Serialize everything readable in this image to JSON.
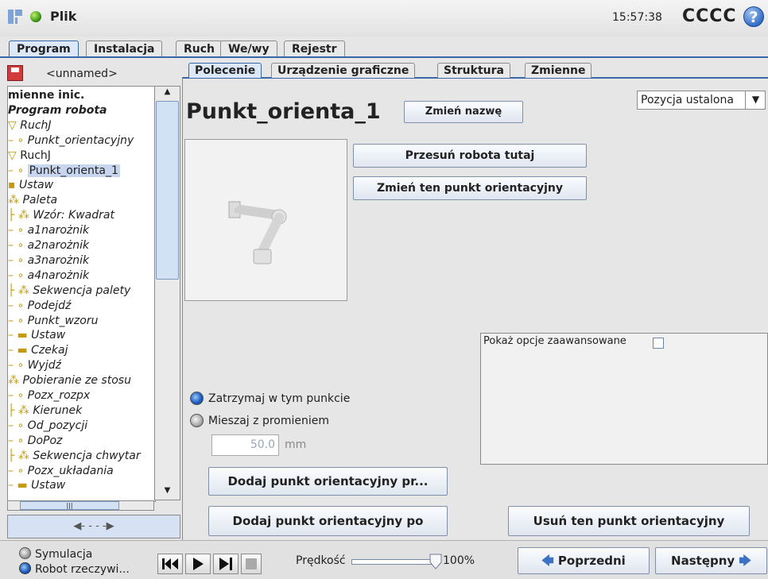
{
  "header": {
    "app_title": "Plik",
    "clock": "15:57:38",
    "robot_name": "CCCC",
    "help": "?"
  },
  "main_tabs": [
    "Program",
    "Instalacja",
    "Ruch",
    "We/wy",
    "Rejestr"
  ],
  "left": {
    "file_name": "<unnamed>",
    "tree": [
      {
        "label": "mienne inic.",
        "style": "bold",
        "prefix": ""
      },
      {
        "label": "Program robota",
        "style": "bold-italic",
        "prefix": ""
      },
      {
        "label": "RuchJ",
        "style": "italic",
        "prefix": "▽ "
      },
      {
        "label": "Punkt_orientacyjny",
        "style": "italic",
        "prefix": "– ∘ "
      },
      {
        "label": "RuchJ",
        "style": "normal",
        "prefix": "▽ "
      },
      {
        "label": "Punkt_orienta_1",
        "style": "selected",
        "prefix": "– ∘ "
      },
      {
        "label": "Ustaw",
        "style": "italic",
        "prefix": "▪ "
      },
      {
        "label": "Paleta",
        "style": "italic",
        "prefix": "⁂ "
      },
      {
        "label": "Wzór: Kwadrat",
        "style": "italic",
        "prefix": "├ ⁂ "
      },
      {
        "label": "a1narożnik",
        "style": "italic",
        "prefix": "    – ∘ "
      },
      {
        "label": "a2narożnik",
        "style": "italic",
        "prefix": "    – ∘ "
      },
      {
        "label": "a3narożnik",
        "style": "italic",
        "prefix": "    – ∘ "
      },
      {
        "label": "a4narożnik",
        "style": "italic",
        "prefix": "    – ∘ "
      },
      {
        "label": "Sekwencja palety",
        "style": "italic",
        "prefix": "├ ⁂ "
      },
      {
        "label": "Podejdź",
        "style": "italic",
        "prefix": "    – ∘ "
      },
      {
        "label": "Punkt_wzoru",
        "style": "italic",
        "prefix": "    – ∘ "
      },
      {
        "label": "Ustaw",
        "style": "italic",
        "prefix": "    – ▬ "
      },
      {
        "label": "Czekaj",
        "style": "italic",
        "prefix": "    – ▬ "
      },
      {
        "label": "Wyjdź",
        "style": "italic",
        "prefix": "    – ∘ "
      },
      {
        "label": "Pobieranie ze stosu",
        "style": "italic",
        "prefix": "⁂ "
      },
      {
        "label": "Pozx_rozpx",
        "style": "italic",
        "prefix": "– ∘ "
      },
      {
        "label": "Kierunek",
        "style": "italic",
        "prefix": "├ ⁂ "
      },
      {
        "label": "Od_pozycji",
        "style": "italic",
        "prefix": "    – ∘ "
      },
      {
        "label": "DoPoz",
        "style": "italic",
        "prefix": "    – ∘ "
      },
      {
        "label": "Sekwencja chwytar",
        "style": "italic",
        "prefix": "├ ⁂ "
      },
      {
        "label": "Pozx_układania",
        "style": "italic",
        "prefix": "    – ∘ "
      },
      {
        "label": "Ustaw",
        "style": "italic",
        "prefix": "    – ▬ "
      }
    ]
  },
  "sub_tabs": [
    "Polecenie",
    "Urządzenie graficzne",
    "Struktura",
    "Zmienne"
  ],
  "waypoint": {
    "title": "Punkt_orienta_1",
    "rename_button": "Zmień nazwę",
    "position_type": "Pozycja ustalona",
    "move_here_button": "Przesuń robota tutaj",
    "change_waypoint_button": "Zmień ten punkt orientacyjny",
    "advanced_label": "Pokaż opcje zaawansowane",
    "stop_label": "Zatrzymaj w tym punkcie",
    "blend_label": "Mieszaj z promieniem",
    "radius_value": "50.0",
    "radius_unit": "mm",
    "add_before_button": "Dodaj punkt orientacyjny pr...",
    "add_after_button": "Dodaj punkt orientacyjny po",
    "delete_button": "Usuń ten punkt orientacyjny"
  },
  "bottom": {
    "simulation_label": "Symulacja",
    "real_robot_label": "Robot rzeczywi...",
    "speed_label": "Prędkość",
    "speed_value": "100%",
    "speed_fraction": 1.0,
    "prev_button": "Poprzedni",
    "next_button": "Następny"
  },
  "colors": {
    "accent": "#3a67a8",
    "selection": "#c7d6ee",
    "status_ok": "#2f8a0c"
  }
}
